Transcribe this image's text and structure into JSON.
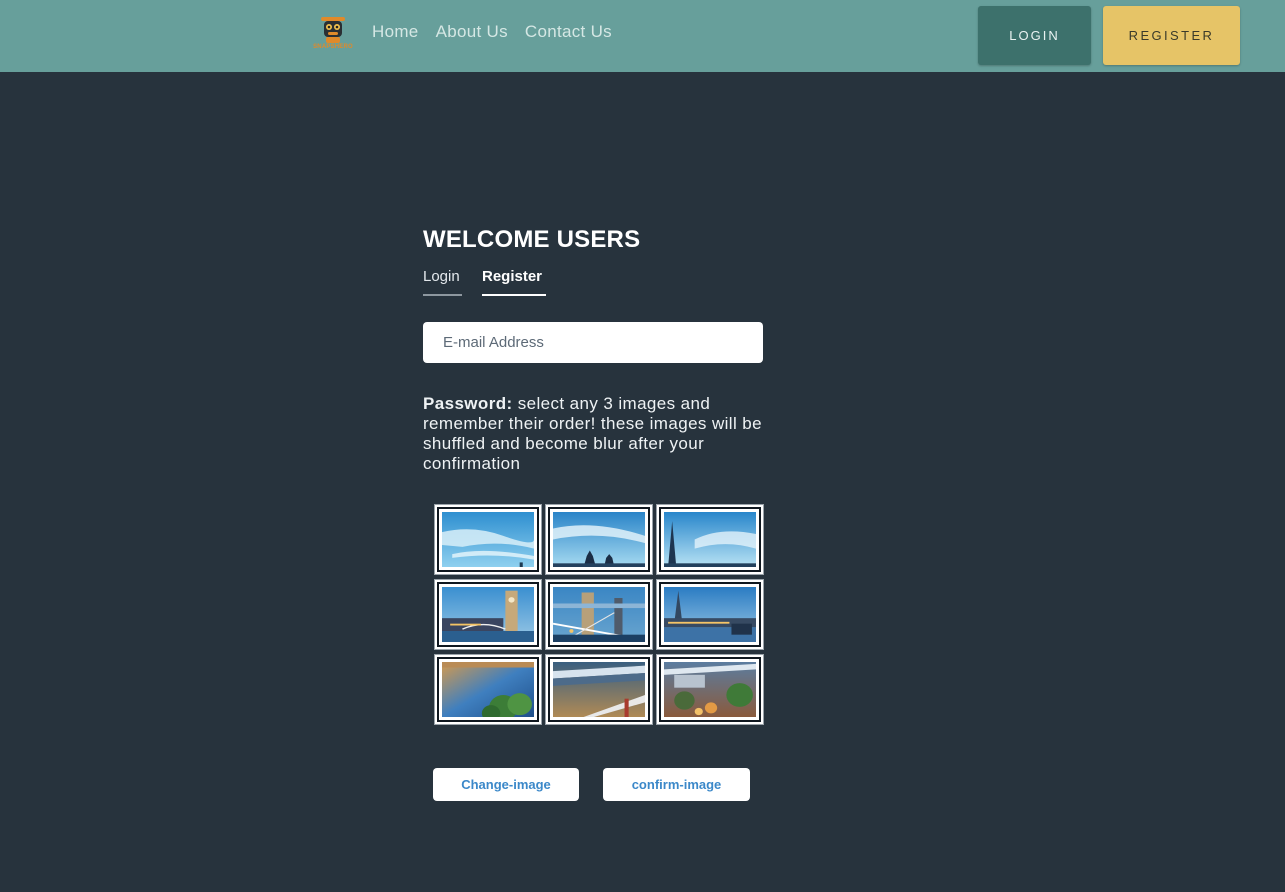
{
  "navbar": {
    "logo_text": "SNAPSHERO",
    "links": [
      {
        "label": "Home"
      },
      {
        "label": "About Us"
      },
      {
        "label": "Contact Us"
      }
    ],
    "login_label": "LOGIN",
    "register_label": "REGISTER",
    "colors": {
      "bar": "#679f9b",
      "login": "#3d716c",
      "register": "#e6c467"
    }
  },
  "main": {
    "title": "WELCOME USERS",
    "tabs": [
      {
        "label": "Login",
        "active": false
      },
      {
        "label": "Register",
        "active": true
      }
    ],
    "email_placeholder": "E-mail Address",
    "password_label": "Password:",
    "password_hint": " select any 3 images and remember their order! these images will be shuffled and become blur after your confirmation",
    "images": [
      {
        "name": "sky-clouds"
      },
      {
        "name": "sky-tower-bridge-tops"
      },
      {
        "name": "sky-shard"
      },
      {
        "name": "tower-bridge-clock"
      },
      {
        "name": "tower-bridge-night"
      },
      {
        "name": "shard-riverside"
      },
      {
        "name": "river-trees"
      },
      {
        "name": "bridge-river"
      },
      {
        "name": "riverside-trees-evening"
      }
    ],
    "change_button": "Change-image",
    "confirm_button": "confirm-image"
  }
}
